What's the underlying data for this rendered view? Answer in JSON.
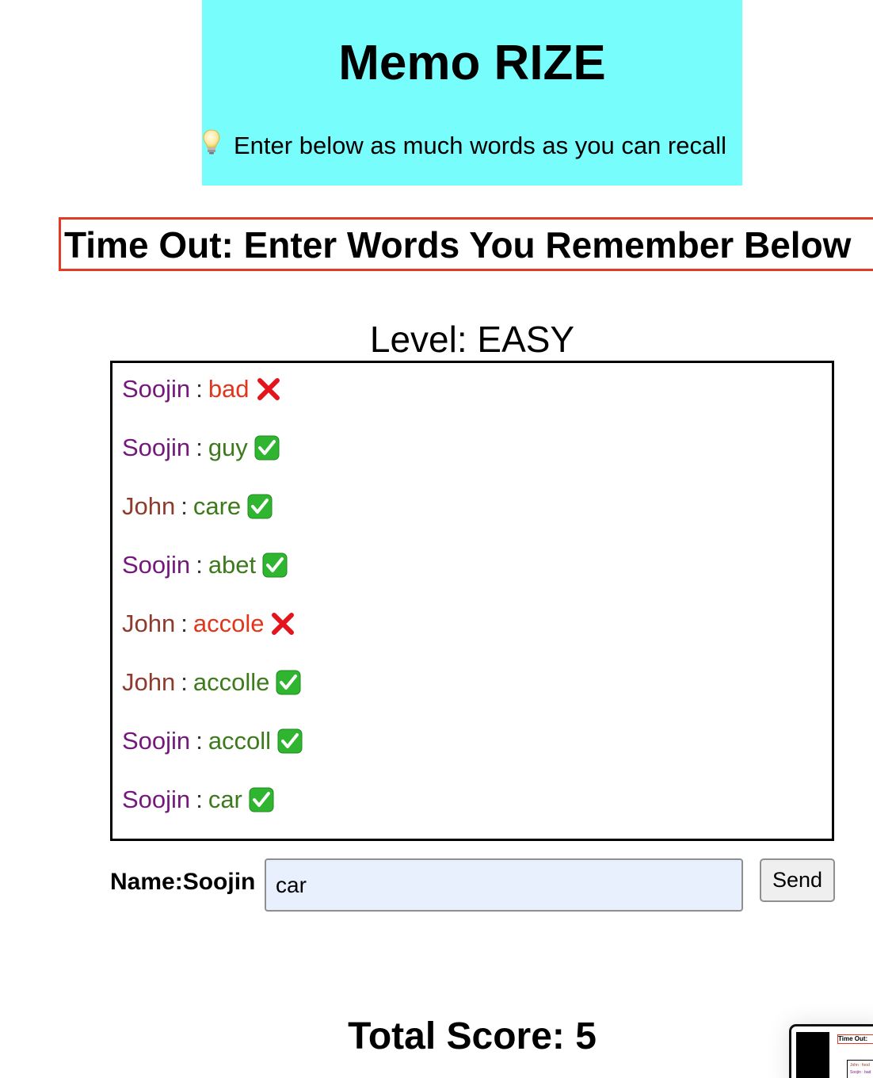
{
  "header": {
    "title": "Memo RIZE",
    "hint": "Enter below as much words as you can recall",
    "hint_icon": "lightbulb-icon",
    "background": "#78fdfd"
  },
  "banner": {
    "text": "Time Out: Enter Words You Remember Below",
    "border_color": "#e23a23"
  },
  "level": {
    "label": "Level: EASY"
  },
  "entries": [
    {
      "name": "Soojin",
      "sep": ":",
      "word": "bad",
      "correct": false
    },
    {
      "name": "Soojin",
      "sep": ":",
      "word": "guy",
      "correct": true
    },
    {
      "name": "John",
      "sep": ":",
      "word": "care",
      "correct": true
    },
    {
      "name": "Soojin",
      "sep": ":",
      "word": "abet",
      "correct": true
    },
    {
      "name": "John",
      "sep": ":",
      "word": "accole",
      "correct": false
    },
    {
      "name": "John",
      "sep": ":",
      "word": "accolle",
      "correct": true
    },
    {
      "name": "Soojin",
      "sep": ":",
      "word": "accoll",
      "correct": true
    },
    {
      "name": "Soojin",
      "sep": ":",
      "word": "car",
      "correct": true
    }
  ],
  "colors": {
    "player_soojin": "#74187c",
    "player_john": "#8e3a2c",
    "correct_word": "#3d7a1c",
    "wrong_word": "#e2351c",
    "check_mark_bg": "#2fb52f",
    "cross_mark": "#e4141c"
  },
  "form": {
    "name_label": "Name:Soojin",
    "input_value": "car",
    "send_label": "Send"
  },
  "score": {
    "text": "Total Score: 5"
  },
  "thumbnail": {
    "title": "Time Out:",
    "row1": "John : food",
    "row2": "Soojin : bad"
  }
}
